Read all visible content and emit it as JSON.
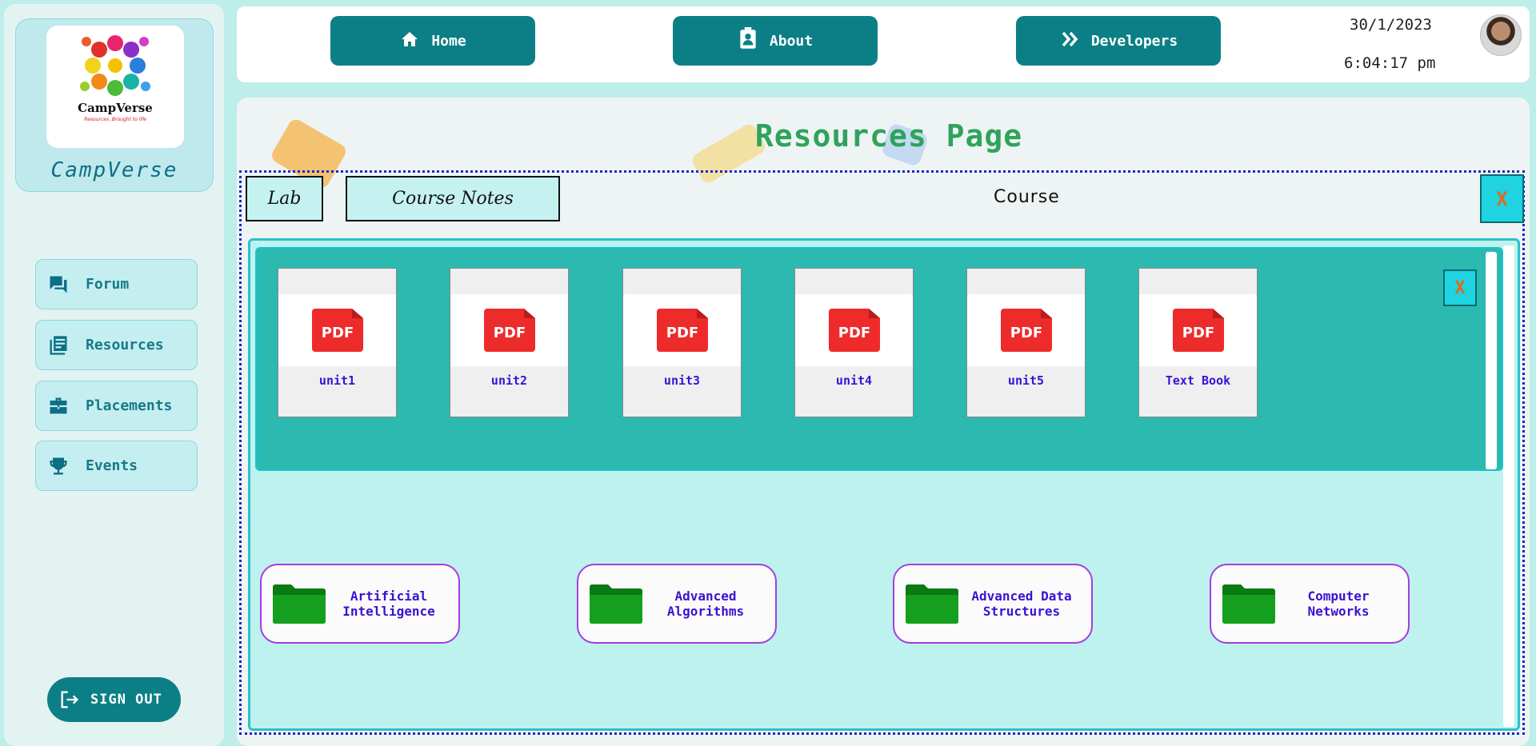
{
  "brand": {
    "logo_word": "CampVerse",
    "logo_tagline": "Resources ,Brought to life",
    "name": "CampVerse"
  },
  "sidebar": {
    "items": [
      {
        "label": "Forum",
        "icon": "forum-icon"
      },
      {
        "label": "Resources",
        "icon": "book-icon"
      },
      {
        "label": "Placements",
        "icon": "briefcase-icon"
      },
      {
        "label": "Events",
        "icon": "trophy-icon"
      }
    ],
    "signout_label": "SIGN OUT"
  },
  "header": {
    "nav": [
      {
        "label": "Home",
        "icon": "home-icon"
      },
      {
        "label": "About",
        "icon": "contact-card-icon"
      },
      {
        "label": "Developers",
        "icon": "double-chevron-icon"
      }
    ],
    "date": "30/1/2023",
    "time": "6:04:17 pm"
  },
  "page": {
    "title": "Resources Page",
    "tabs": [
      "Lab",
      "Course Notes"
    ],
    "course_label": "Course",
    "close_label": "X"
  },
  "pdfs": [
    {
      "label": "unit1"
    },
    {
      "label": "unit2"
    },
    {
      "label": "unit3"
    },
    {
      "label": "unit4"
    },
    {
      "label": "unit5"
    },
    {
      "label": "Text Book"
    }
  ],
  "pdf_badge": "PDF",
  "courses": [
    {
      "line1": "Artificial",
      "line2": "Intelligence"
    },
    {
      "line1": "Advanced",
      "line2": "Algorithms"
    },
    {
      "line1": "Advanced Data",
      "line2": "Structures"
    },
    {
      "line1": "Computer",
      "line2": "Networks"
    }
  ],
  "colors": {
    "accent": "#0c7f86",
    "title_green": "#2fa35a",
    "link_purple": "#3a12d1",
    "pdf_red": "#ee2b2b"
  }
}
